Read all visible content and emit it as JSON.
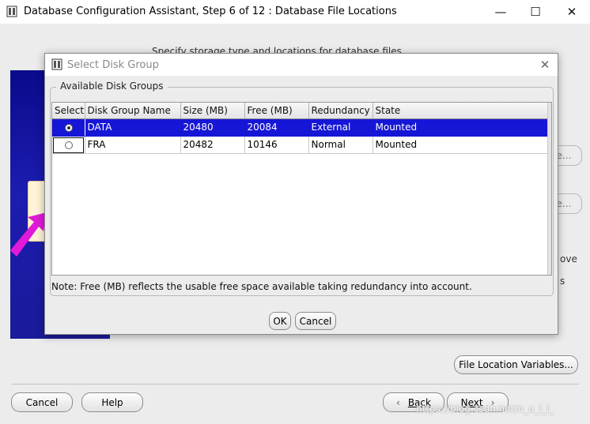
{
  "window": {
    "title": "Database Configuration Assistant, Step 6 of 12 : Database File Locations",
    "minimize_glyph": "—",
    "maximize_glyph": "☐",
    "close_glyph": "✕"
  },
  "page": {
    "subtitle": "Specify storage type and locations for database files.",
    "browse_button_1": "e...",
    "browse_button_2": "e...",
    "partial_text_1": "ove",
    "partial_text_2": "s",
    "file_location_variables_button": "File Location Variables...",
    "cancel_button": "Cancel",
    "help_button": "Help",
    "back_button": "Back",
    "next_button": "Next",
    "back_glyph": "‹",
    "next_glyph": "›",
    "watermark": "https://blog.csdn.net/n_u_l_l_"
  },
  "dialog": {
    "title": "Select Disk Group",
    "close_glyph": "✕",
    "group_label": "Available Disk Groups",
    "columns": [
      "Select",
      "Disk Group Name",
      "Size (MB)",
      "Free (MB)",
      "Redundancy",
      "State"
    ],
    "rows": [
      {
        "selected": true,
        "name": "DATA",
        "size": "20480",
        "free": "20084",
        "redundancy": "External",
        "state": "Mounted"
      },
      {
        "selected": false,
        "name": "FRA",
        "size": "20482",
        "free": "10146",
        "redundancy": "Normal",
        "state": "Mounted"
      }
    ],
    "note": "Note:  Free (MB) reflects the usable free space available taking redundancy into account.",
    "ok_button": "OK",
    "cancel_button": "Cancel"
  },
  "colors": {
    "selection": "#1616d6",
    "side_banner": "#1a1a9a",
    "arrow": "#e01ad8"
  }
}
